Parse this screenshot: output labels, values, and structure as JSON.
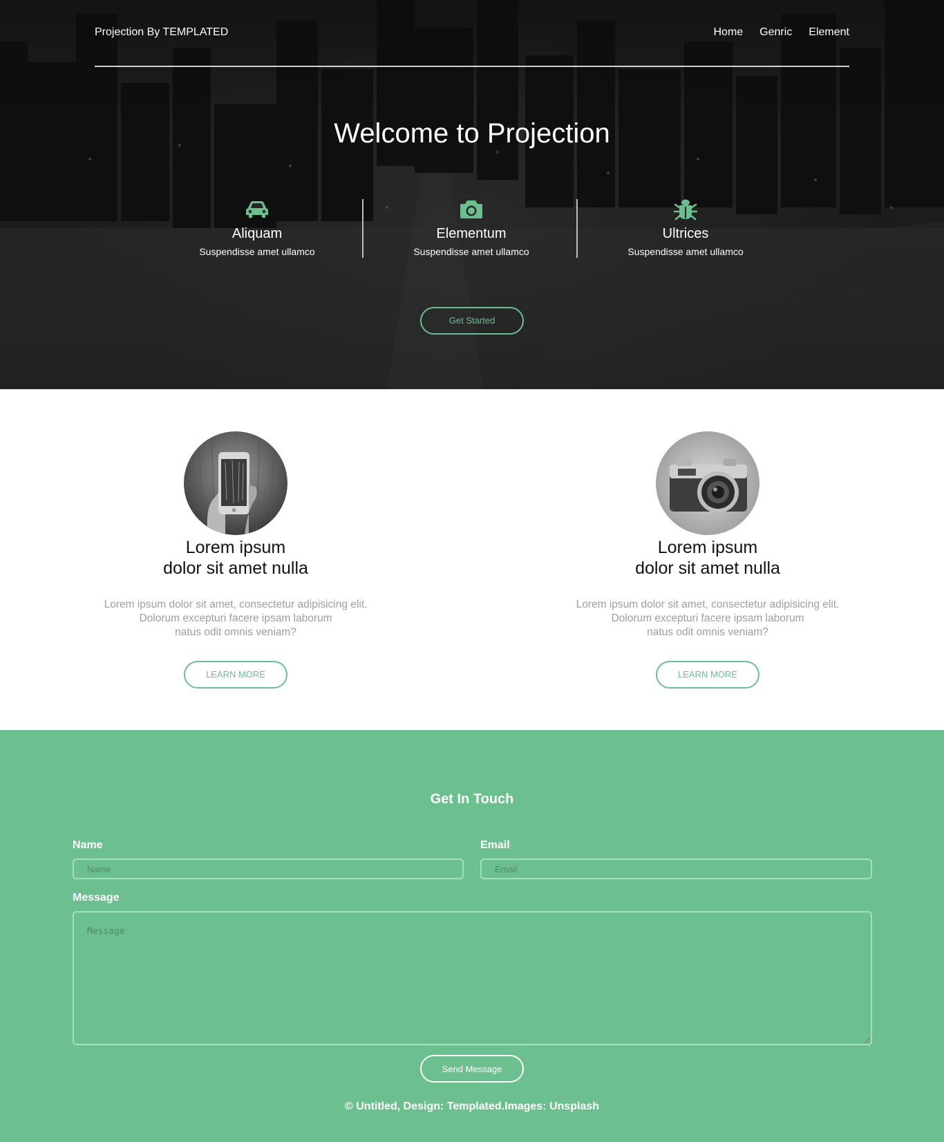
{
  "nav": {
    "brand": "Projection By TEMPLATED",
    "links": [
      "Home",
      "Genric",
      "Element"
    ]
  },
  "hero": {
    "title": "Welcome to Projection",
    "features": [
      {
        "icon": "car-icon",
        "title": "Aliquam",
        "subtitle": "Suspendisse amet ullamco"
      },
      {
        "icon": "camera-icon",
        "title": "Elementum",
        "subtitle": "Suspendisse amet ullamco"
      },
      {
        "icon": "bug-icon",
        "title": "Ultrices",
        "subtitle": "Suspendisse amet ullamco"
      }
    ],
    "cta_label": "Get Started"
  },
  "cards": [
    {
      "image": "phone-photo",
      "title_line1": "Lorem ipsum",
      "title_line2": "dolor sit amet nulla",
      "text_line1": "Lorem ipsum dolor sit amet, consectetur adipisicing elit.",
      "text_line2": "Dolorum excepturi facere ipsam laborum",
      "text_line3": "natus odit omnis veniam?",
      "button_label": "LEARN MORE"
    },
    {
      "image": "camera-photo",
      "title_line1": "Lorem ipsum",
      "title_line2": "dolor sit amet nulla",
      "text_line1": "Lorem ipsum dolor sit amet, consectetur adipisicing elit.",
      "text_line2": "Dolorum excepturi facere ipsam laborum",
      "text_line3": "natus odit omnis veniam?",
      "button_label": "LEARN MORE"
    }
  ],
  "contact": {
    "title": "Get In Touch",
    "name_label": "Name",
    "name_placeholder": "Name",
    "email_label": "Email",
    "email_placeholder": "Email",
    "message_label": "Message",
    "message_placeholder": "Message",
    "send_label": "Send Message"
  },
  "footer": {
    "text": "© Untitled, Design: Templated.Images: Unsplash"
  },
  "colors": {
    "accent": "#6cc08f",
    "button_border": "#6bbf8e",
    "hero_bg": "#1f1f1f"
  }
}
